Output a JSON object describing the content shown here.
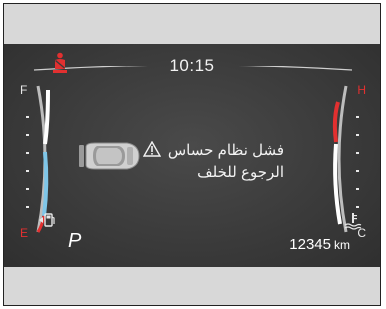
{
  "cluster": {
    "time": "10:15",
    "gear": "P",
    "odometer": {
      "value": "12345",
      "unit": "km"
    },
    "warning": {
      "line1": "فشل نظام حساس",
      "line2": "الرجوع للخلف"
    },
    "fuel_gauge": {
      "full_label": "F",
      "empty_label": "E"
    },
    "temp_gauge": {
      "hot_label": "H",
      "cold_label": "C"
    },
    "icons": [
      "seatbelt-warning-icon",
      "car-icon",
      "warning-triangle-icon",
      "fuel-pump-icon",
      "coolant-temperature-icon"
    ],
    "colors": {
      "background": "#3b3b3b",
      "frame": "#d8d8d8",
      "alert_red": "#e23030",
      "gauge_blue": "#7fc6e8",
      "text": "#f2f2f2"
    }
  }
}
